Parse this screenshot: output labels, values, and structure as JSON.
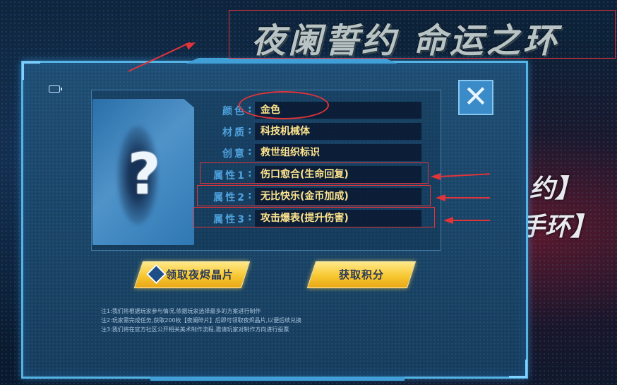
{
  "banner": {
    "title": "夜阑誓约 命运之环"
  },
  "background_text": {
    "line1": "约】",
    "line2": "手环】"
  },
  "dialog": {
    "close_glyph": "✕",
    "attributes": [
      {
        "label": "颜色",
        "value": "金色"
      },
      {
        "label": "材质",
        "value": "科技机械体"
      },
      {
        "label": "创意",
        "value": "救世组织标识"
      },
      {
        "label": "属性1",
        "value": "伤口愈合(生命回复)"
      },
      {
        "label": "属性2",
        "value": "无比快乐(金币加成)"
      },
      {
        "label": "属性3",
        "value": "攻击爆表(提升伤害)"
      }
    ],
    "buttons": {
      "claim_label": "领取夜烬晶片",
      "points_label": "获取积分"
    },
    "notes": [
      "注1:我们将根据玩家参与情况,依据玩家选择最多的方案进行制作",
      "注2:玩家需完成任务,获取200枚【夜阑碎片】后即可领取夜烬晶片,以便后续兑换",
      "注3:我们将在官方社区公开相关美术制作流程,邀请玩家对制作方向进行投票"
    ],
    "card_symbol": "?"
  },
  "colors": {
    "annotation": "#e0343a",
    "frame": "#56b4e4",
    "value_text": "#fce38c",
    "label_text": "#4fa2de",
    "button_gold": "#f7c731"
  }
}
